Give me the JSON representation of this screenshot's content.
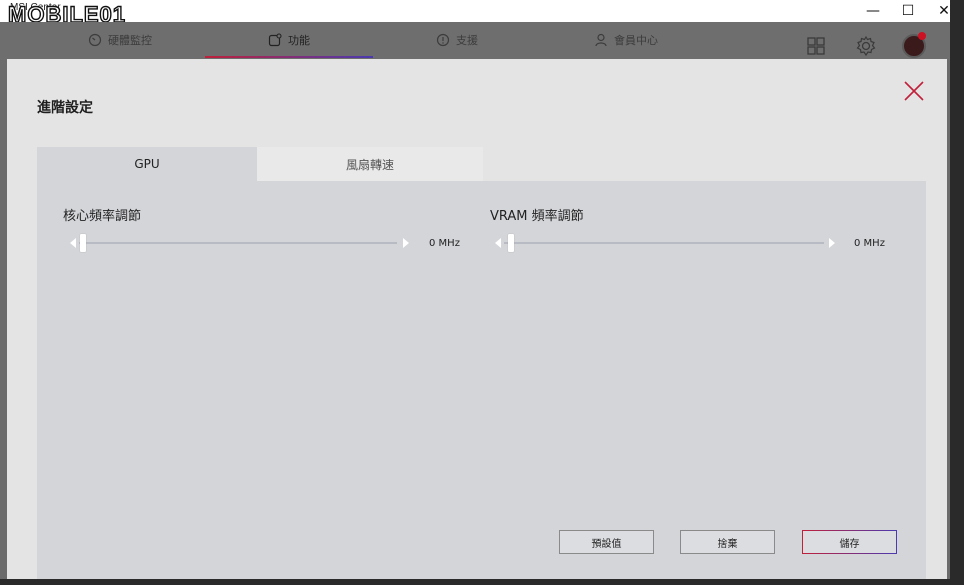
{
  "window": {
    "title": "MSI Center",
    "watermark": "MOBILE01",
    "min_glyph": "—",
    "max_glyph": "☐",
    "close_glyph": "✕"
  },
  "nav": {
    "items": [
      {
        "label": "硬體監控",
        "icon": "gauge-icon"
      },
      {
        "label": "功能",
        "icon": "feature-icon"
      },
      {
        "label": "支援",
        "icon": "support-chat-icon"
      },
      {
        "label": "會員中心",
        "icon": "user-icon"
      }
    ],
    "active_index": 1,
    "header_icons": [
      "grid-apps-icon",
      "settings-gear-icon",
      "avatar"
    ]
  },
  "modal": {
    "title": "進階設定",
    "tabs": [
      {
        "label": "GPU",
        "active": true
      },
      {
        "label": "風扇轉速",
        "active": false
      }
    ],
    "sliders": [
      {
        "label": "核心頻率調節",
        "value_text": "0 MHz",
        "value": 0
      },
      {
        "label": "VRAM 頻率調節",
        "value_text": "0 MHz",
        "value": 0
      }
    ],
    "buttons": {
      "default": "預設值",
      "discard": "捨棄",
      "save": "儲存"
    }
  },
  "colors": {
    "accent_red": "#c0203a",
    "accent_purple": "#4a3ab0",
    "modal_bg": "#e4e4e4",
    "panel_bg": "#d4d5d9"
  }
}
